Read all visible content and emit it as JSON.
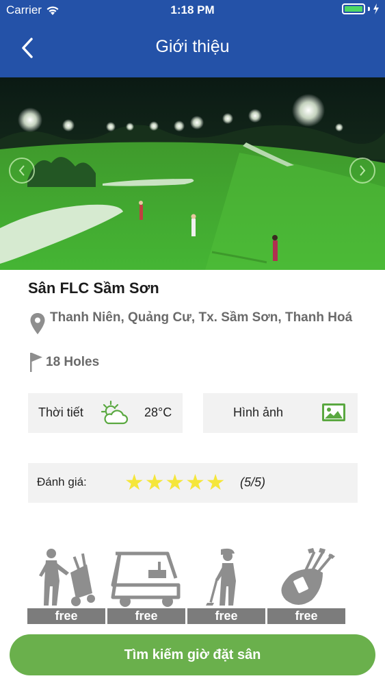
{
  "status_bar": {
    "carrier": "Carrier",
    "time": "1:18 PM"
  },
  "nav": {
    "title": "Giới thiệu"
  },
  "course": {
    "name": "Sân FLC Sầm Sơn",
    "address": "Thanh Niên, Quảng Cư, Tx. Sầm Sơn, Thanh Hoá",
    "holes": "18 Holes"
  },
  "weather": {
    "label": "Thời tiết",
    "temperature": "28°C",
    "icon": "partly-cloudy-icon"
  },
  "photos": {
    "label": "Hình ảnh",
    "icon": "image-icon"
  },
  "rating": {
    "label": "Đánh giá:",
    "stars": 5,
    "max": 5,
    "score_text": "(5/5)"
  },
  "services": [
    {
      "icon": "caddie-icon",
      "label": "free"
    },
    {
      "icon": "golf-cart-icon",
      "label": "free"
    },
    {
      "icon": "golfer-icon",
      "label": "free"
    },
    {
      "icon": "golf-bag-icon",
      "label": "free"
    }
  ],
  "cta": {
    "label": "Tìm kiếm giờ đặt sân"
  },
  "colors": {
    "header": "#2452a8",
    "accent_green": "#6ab04c",
    "star": "#f5e63a",
    "service_badge": "#7c7c7c"
  }
}
